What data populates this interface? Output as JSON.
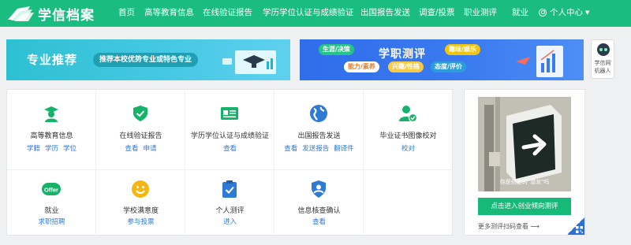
{
  "header": {
    "logo_text": "学信档案",
    "nav": [
      "首页",
      "高等教育信息",
      "在线验证报告",
      "学历学位认证与成绩验证",
      "出国报告发送",
      "调查/投票",
      "职业测评",
      "就业"
    ],
    "user_menu": "个人中心"
  },
  "banners": {
    "left": {
      "title": "专业推荐",
      "subtitle": "推荐本校优势专业或特色专业"
    },
    "right": {
      "title": "学职测评",
      "tags": [
        "生涯/决策",
        "趣味/娱乐",
        "能力/素养",
        "兴趣/性格",
        "态度/评价"
      ]
    }
  },
  "robot": {
    "line1": "学信网",
    "line2": "机器人"
  },
  "services": [
    {
      "title": "高等教育信息",
      "links": [
        "学籍",
        "学历",
        "学位"
      ],
      "icon": "graduate-icon"
    },
    {
      "title": "在线验证报告",
      "links": [
        "查看",
        "申请"
      ],
      "icon": "shield-check-icon"
    },
    {
      "title": "学历学位认证与成绩验证",
      "links": [
        "查看"
      ],
      "icon": "id-card-icon"
    },
    {
      "title": "出国报告发送",
      "links": [
        "查看",
        "发送报告",
        "翻译件"
      ],
      "icon": "globe-icon"
    },
    {
      "title": "毕业证书图像校对",
      "links": [
        "校对"
      ],
      "icon": "user-check-icon"
    },
    {
      "title": "就业",
      "links": [
        "求职招聘"
      ],
      "icon": "offer-icon"
    },
    {
      "title": "学校满意度",
      "links": [
        "参与投票"
      ],
      "icon": "smile-icon"
    },
    {
      "title": "个人测评",
      "links": [
        "进入"
      ],
      "icon": "clipboard-check-icon"
    },
    {
      "title": "信息核查确认",
      "links": [
        "查看"
      ],
      "icon": "user-shield-icon"
    }
  ],
  "promo": {
    "caption": "你是创业的\"潜龙\"吗",
    "button": "点击进入创业倾向测评",
    "more": "更多测评扫码查看"
  },
  "colors": {
    "brand": "#1abc80",
    "link": "#2e7bd6",
    "icon_green": "#17b26a",
    "icon_blue": "#2e7bd6",
    "icon_yellow": "#f5b70f"
  }
}
